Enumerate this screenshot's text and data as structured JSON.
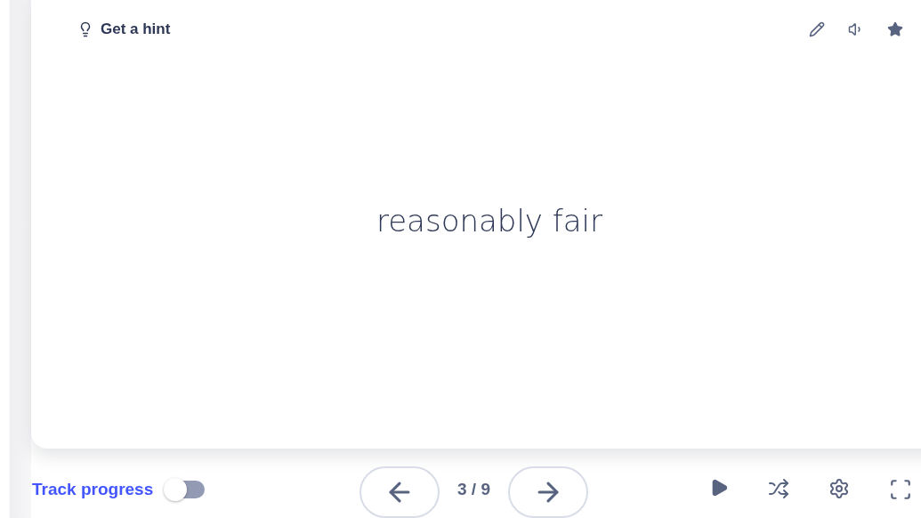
{
  "card": {
    "hint": {
      "label": "Get a hint"
    },
    "term": "reasonably fair",
    "starred": true
  },
  "footer": {
    "track_progress": {
      "label": "Track progress",
      "on": false
    },
    "counter": "3 / 9"
  }
}
